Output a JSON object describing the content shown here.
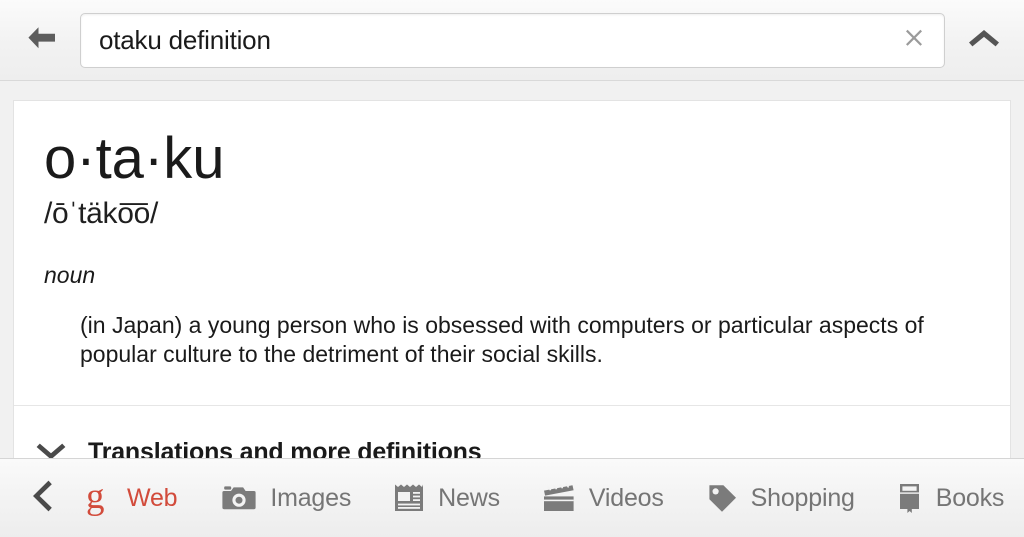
{
  "colors": {
    "page_bg": "#f1f1f1",
    "card_bg": "#ffffff",
    "text": "#1a1a1a",
    "muted_icon": "#7b7b7b",
    "nav_label": "#757575",
    "google_red": "#d24b3b"
  },
  "topbar": {
    "back_icon": "arrow-left-icon",
    "search": {
      "value": "otaku definition",
      "placeholder": "Search",
      "clear_icon": "close-icon"
    },
    "collapse_icon": "chevron-up-icon"
  },
  "definition_card": {
    "headword": "o·ta·ku",
    "pronunciation": "/ōˈtäko͞o/",
    "part_of_speech": "noun",
    "senses": [
      "(in Japan) a young person who is obsessed with computers or particular aspects of popular culture to the detriment of their social skills."
    ],
    "more": {
      "chevron_icon": "chevron-down-icon",
      "label": "Translations and more definitions"
    }
  },
  "bottom_nav": {
    "back_icon": "chevron-left-icon",
    "items": [
      {
        "label": "Web",
        "icon": "google-g-icon",
        "active": true
      },
      {
        "label": "Images",
        "icon": "camera-icon",
        "active": false
      },
      {
        "label": "News",
        "icon": "newspaper-icon",
        "active": false
      },
      {
        "label": "Videos",
        "icon": "clapperboard-icon",
        "active": false
      },
      {
        "label": "Shopping",
        "icon": "price-tag-icon",
        "active": false
      },
      {
        "label": "Books",
        "icon": "book-icon",
        "active": false
      }
    ]
  }
}
